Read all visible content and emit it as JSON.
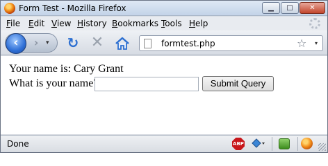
{
  "window": {
    "title": "Form Test - Mozilla Firefox",
    "controls": {
      "minimize": "▁",
      "maximize": "□",
      "close": "✕"
    }
  },
  "menubar": {
    "items": [
      {
        "label": "File",
        "accel": "F",
        "rest": "ile"
      },
      {
        "label": "Edit",
        "accel": "E",
        "rest": "dit"
      },
      {
        "label": "View",
        "accel": "V",
        "rest": "iew"
      },
      {
        "label": "History",
        "accel": "H",
        "rest": "istory"
      },
      {
        "label": "Bookmarks",
        "accel": "B",
        "rest": "ookmarks"
      },
      {
        "label": "Tools",
        "accel": "T",
        "rest": "ools"
      },
      {
        "label": "Help",
        "accel": "H",
        "rest": "elp"
      }
    ]
  },
  "navbar": {
    "back_glyph": "‹",
    "forward_glyph": "›",
    "history_glyph": "▾",
    "reload_glyph": "↻",
    "stop_glyph": "✕",
    "url": "formtest.php",
    "star_glyph": "☆",
    "url_dropdown_glyph": "▾"
  },
  "content": {
    "greeting": "Your name is: Cary Grant",
    "prompt": "What is your name?",
    "name_input_value": "",
    "submit_label": "Submit Query"
  },
  "statusbar": {
    "status": "Done",
    "abp_label": "ABP"
  },
  "icons": {
    "firefox_logo": "firefox-logo-icon",
    "home": "home-icon",
    "page": "page-icon",
    "adblock": "adblock-icon"
  }
}
